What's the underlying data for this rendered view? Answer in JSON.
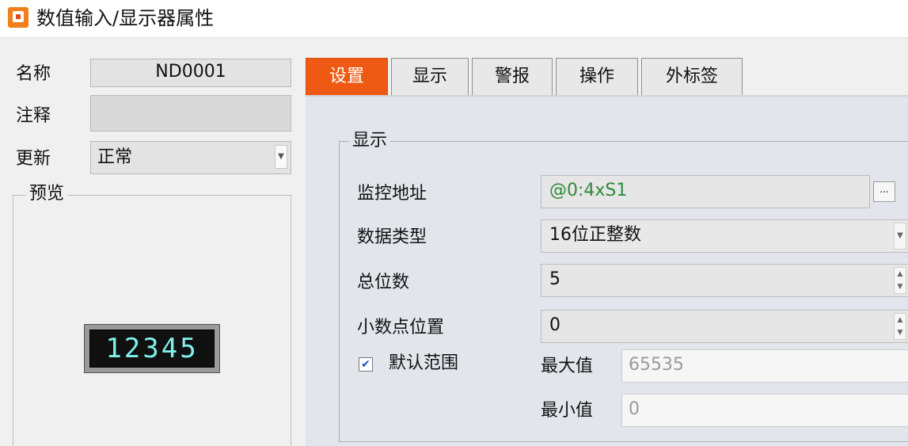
{
  "window": {
    "title": "数值输入/显示器属性",
    "icon": "app-icon"
  },
  "left": {
    "name_label": "名称",
    "name_value": "ND0001",
    "comment_label": "注释",
    "comment_value": "",
    "update_label": "更新",
    "update_value": "正常",
    "preview_label": "预览",
    "preview_display": "12345"
  },
  "tabs": [
    {
      "label": "设置",
      "active": true
    },
    {
      "label": "显示",
      "active": false
    },
    {
      "label": "警报",
      "active": false
    },
    {
      "label": "操作",
      "active": false
    },
    {
      "label": "外标签",
      "active": false
    }
  ],
  "display_group": {
    "title": "显示",
    "monitor_address_label": "监控地址",
    "monitor_address_value": "@0:4xS1",
    "browse_button": "...",
    "data_type_label": "数据类型",
    "data_type_value": "16位正整数",
    "total_digits_label": "总位数",
    "total_digits_value": "5",
    "decimal_position_label": "小数点位置",
    "decimal_position_value": "0",
    "default_range_label": "默认范围",
    "default_range_checked": true,
    "max_label": "最大值",
    "max_value": "65535",
    "min_label": "最小值",
    "min_value": "0"
  },
  "colors": {
    "active_tab": "#ee5a14",
    "address_text": "#2e8b3a",
    "lcd_digits": "#7ff0ea"
  }
}
